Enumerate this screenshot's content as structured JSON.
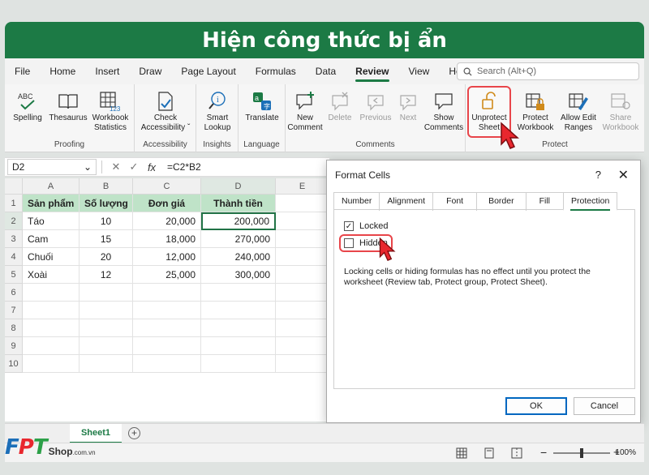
{
  "banner": {
    "title": "Hiện công thức bị ẩn"
  },
  "menu": {
    "items": [
      "File",
      "Home",
      "Insert",
      "Draw",
      "Page Layout",
      "Formulas",
      "Data",
      "Review",
      "View",
      "Help"
    ],
    "active": "Review",
    "search_placeholder": "Search (Alt+Q)"
  },
  "ribbon": {
    "proofing": {
      "label": "Proofing",
      "spelling": "Spelling",
      "spelling_icon_text": "ABC",
      "thesaurus": "Thesaurus",
      "workbook_stats_1": "Workbook",
      "workbook_stats_2": "Statistics"
    },
    "accessibility": {
      "label": "Accessibility",
      "check_1": "Check",
      "check_2": "Accessibility ˇ"
    },
    "insights": {
      "label": "Insights",
      "smart_1": "Smart",
      "smart_2": "Lookup"
    },
    "language": {
      "label": "Language",
      "translate": "Translate"
    },
    "comments": {
      "label": "Comments",
      "new_1": "New",
      "new_2": "Comment",
      "delete": "Delete",
      "previous": "Previous",
      "next": "Next",
      "show_1": "Show",
      "show_2": "Comments"
    },
    "protect": {
      "label": "Protect",
      "unprotect_1": "Unprotect",
      "unprotect_2": "Sheet",
      "protect_wb_1": "Protect",
      "protect_wb_2": "Workbook",
      "allow_1": "Allow Edit",
      "allow_2": "Ranges",
      "share_1": "Share",
      "share_2": "Workbook"
    }
  },
  "formula_bar": {
    "name_box": "D2",
    "fx": "fx",
    "formula": "=C2*B2"
  },
  "sheet": {
    "columns": [
      "A",
      "B",
      "C",
      "D",
      "E"
    ],
    "rows": [
      "1",
      "2",
      "3",
      "4",
      "5",
      "6",
      "7",
      "8",
      "9",
      "10"
    ],
    "headers": [
      "Sản phẩm",
      "Số lượng",
      "Đơn giá",
      "Thành tiền"
    ],
    "data": [
      [
        "Táo",
        "10",
        "20,000",
        "200,000"
      ],
      [
        "Cam",
        "15",
        "18,000",
        "270,000"
      ],
      [
        "Chuối",
        "20",
        "12,000",
        "240,000"
      ],
      [
        "Xoài",
        "12",
        "25,000",
        "300,000"
      ]
    ]
  },
  "dialog": {
    "title": "Format Cells",
    "help": "?",
    "close": "✕",
    "tabs": [
      "Number",
      "Alignment",
      "Font",
      "Border",
      "Fill",
      "Protection"
    ],
    "active_tab": "Protection",
    "locked_label": "Locked",
    "locked_checked": true,
    "hidden_label": "Hidden",
    "hidden_checked": false,
    "note": "Locking cells or hiding formulas has no effect until you protect the worksheet (Review tab, Protect group, Protect Sheet).",
    "ok": "OK",
    "cancel": "Cancel"
  },
  "sheet_tabs": {
    "active": "Sheet1",
    "add": "+"
  },
  "status": {
    "zoom": "100%"
  },
  "brand": {
    "logo_text": "FPT",
    "shop": "Shop",
    "domain": ".com.vn"
  },
  "colors": {
    "excel_green": "#1c7a45",
    "header_fill": "#bfe3c8",
    "highlight_red": "#e8454a",
    "ok_blue": "#0067c0"
  }
}
